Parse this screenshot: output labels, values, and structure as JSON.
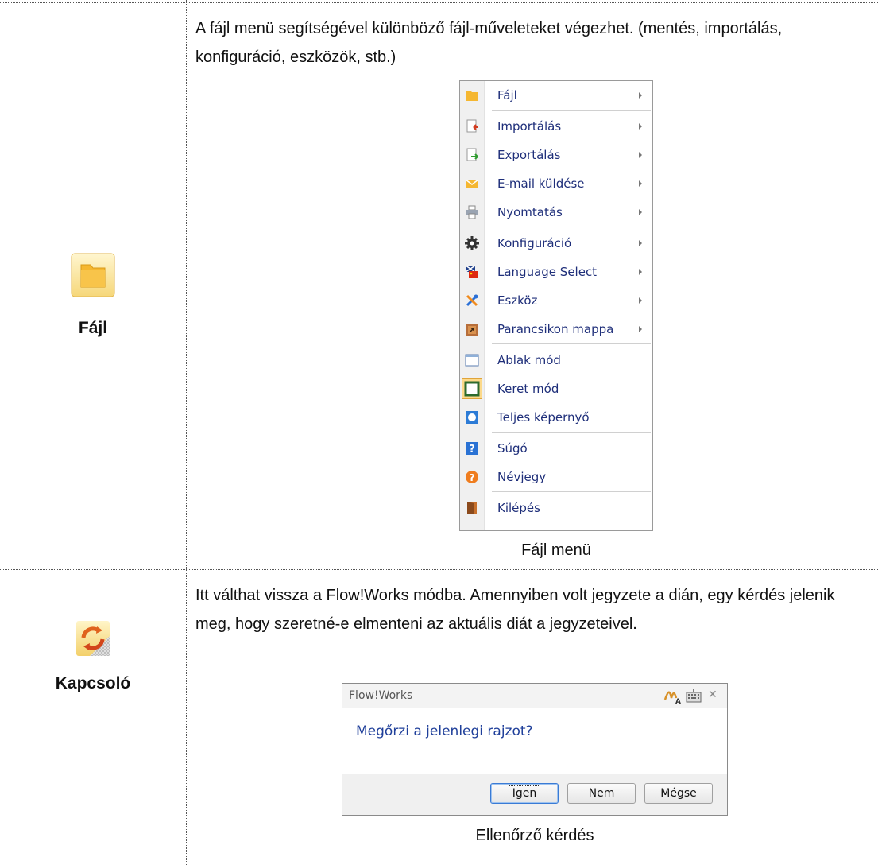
{
  "rows": [
    {
      "label": "Fájl",
      "icon": "folder-icon",
      "description": "A fájl menü segítségével különböző fájl-műveleteket végezhet. (mentés, importálás, konfiguráció, eszközök, stb.)",
      "caption": "Fájl menü"
    },
    {
      "label": "Kapcsoló",
      "icon": "switch-arrows-icon",
      "description": "Itt válthat vissza a Flow!Works módba. Amennyiben volt jegyzete a dián, egy kérdés jelenik meg, hogy szeretné-e elmenteni az aktuális diát a jegyzeteivel.",
      "caption": "Ellenőrző kérdés"
    }
  ],
  "file_menu": {
    "items": [
      {
        "label": "Fájl",
        "icon": "folder-icon",
        "submenu": true
      },
      {
        "label": "Importálás",
        "icon": "import-icon",
        "submenu": true
      },
      {
        "label": "Exportálás",
        "icon": "export-icon",
        "submenu": true
      },
      {
        "label": "E-mail küldése",
        "icon": "envelope-icon",
        "submenu": true
      },
      {
        "label": "Nyomtatás",
        "icon": "printer-icon",
        "submenu": true
      },
      {
        "label": "Konfiguráció",
        "icon": "gear-icon",
        "submenu": true
      },
      {
        "label": "Language Select",
        "icon": "flag-icon",
        "submenu": true
      },
      {
        "label": "Eszköz",
        "icon": "tools-icon",
        "submenu": true
      },
      {
        "label": "Parancsikon mappa",
        "icon": "shortcut-folder-icon",
        "submenu": true
      },
      {
        "label": "Ablak mód",
        "icon": "window-icon",
        "submenu": false
      },
      {
        "label": "Keret mód",
        "icon": "frame-icon",
        "submenu": false,
        "highlighted": true
      },
      {
        "label": "Teljes képernyő",
        "icon": "fullscreen-icon",
        "submenu": false
      },
      {
        "label": "Súgó",
        "icon": "help-icon",
        "submenu": false
      },
      {
        "label": "Névjegy",
        "icon": "about-icon",
        "submenu": false
      },
      {
        "label": "Kilépés",
        "icon": "exit-door-icon",
        "submenu": false
      }
    ]
  },
  "dialog": {
    "title": "Flow!Works",
    "message": "Megőrzi a jelenlegi rajzot?",
    "buttons": {
      "yes": "Igen",
      "no": "Nem",
      "cancel": "Mégse"
    }
  },
  "colors": {
    "menu_text": "#1f2f7a",
    "dialog_message": "#1f3f9a",
    "folder": "#f5b731"
  }
}
